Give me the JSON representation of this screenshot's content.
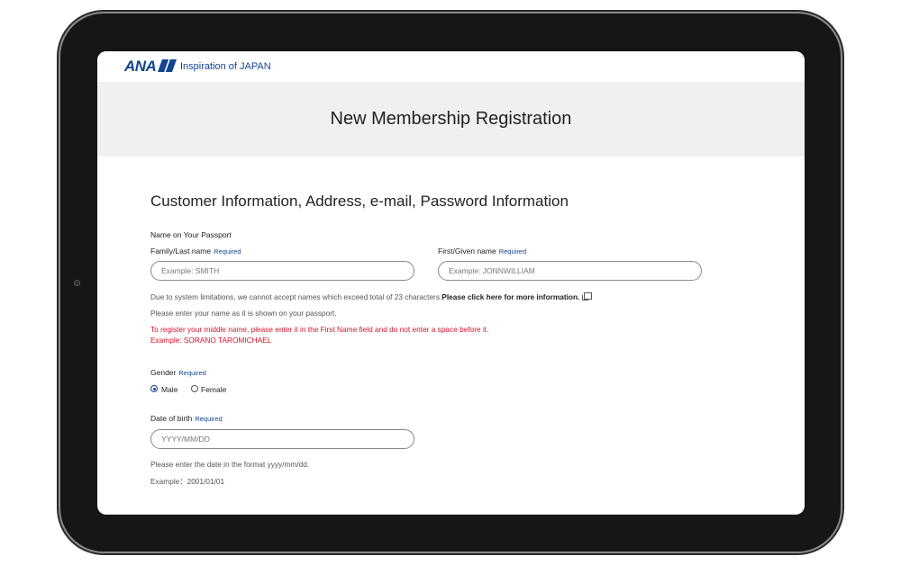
{
  "header": {
    "logo": "ANA",
    "tagline": "Inspiration of JAPAN"
  },
  "banner": {
    "title": "New Membership Registration"
  },
  "form": {
    "section_title": "Customer Information, Address, e-mail, Password Information",
    "passport_group_label": "Name on Your Passport",
    "required_text": "Required",
    "last_name": {
      "label": "Family/Last name",
      "placeholder": "Example: SMITH",
      "value": ""
    },
    "first_name": {
      "label": "First/Given name",
      "placeholder": "Example: JONNWILLIAM",
      "value": ""
    },
    "limit_note": "Due to system limitations, we cannot accept names which exceed total of 23 characters.",
    "more_info_link": "Please click here for more information.",
    "passport_note": "Please enter your name as it is shown on your passport.",
    "middle_name_warning": "To register your middle name, please enter it in the First Name field and do not enter a space before it.",
    "middle_name_example": "Example: SORANO TAROMICHAEL",
    "gender": {
      "label": "Gender",
      "options": [
        "Male",
        "Female"
      ],
      "selected": "Male"
    },
    "dob": {
      "label": "Date of birth",
      "placeholder": "YYYY/MM/DD",
      "value": "",
      "format_note": "Please enter the date in the format yyyy/mm/dd.",
      "example": "Example：2001/01/01"
    }
  },
  "colors": {
    "brand": "#13448f",
    "warning": "#d4132a",
    "banner_bg": "#f0f0f0"
  }
}
